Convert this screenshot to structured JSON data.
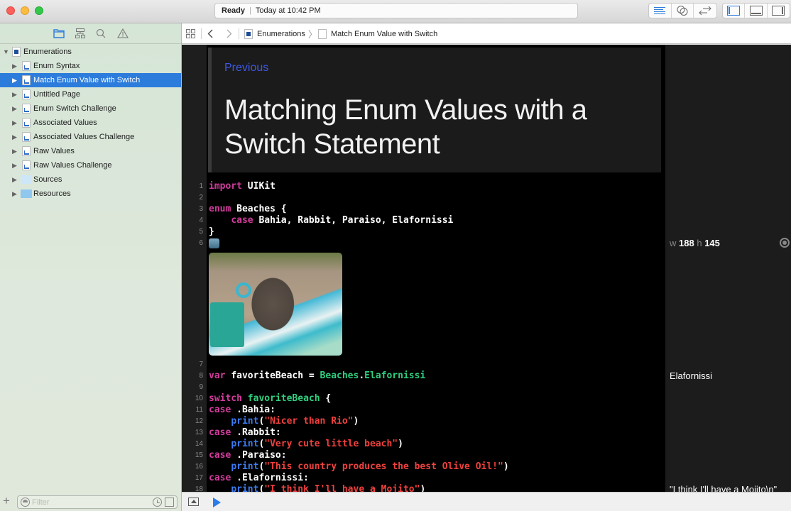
{
  "window": {
    "status": {
      "state": "Ready",
      "time": "Today at 10:42 PM"
    },
    "toolbar": {
      "editor_modes": [
        "standard-editor-icon",
        "assistant-editor-icon",
        "version-editor-icon"
      ],
      "view_toggles": [
        "navigator-toggle-icon",
        "debug-area-toggle-icon",
        "utilities-toggle-icon"
      ]
    }
  },
  "navigator": {
    "tabs": [
      "project-navigator-icon",
      "symbol-navigator-icon",
      "find-navigator-icon",
      "issue-navigator-icon"
    ],
    "root": {
      "label": "Enumerations",
      "expanded": true
    },
    "items": [
      {
        "label": "Enum Syntax",
        "type": "page",
        "selected": false
      },
      {
        "label": "Match Enum Value with Switch",
        "type": "page",
        "selected": true
      },
      {
        "label": "Untitled Page",
        "type": "page",
        "selected": false
      },
      {
        "label": "Enum Switch Challenge",
        "type": "page",
        "selected": false
      },
      {
        "label": "Associated Values",
        "type": "page",
        "selected": false
      },
      {
        "label": "Associated Values Challenge",
        "type": "page",
        "selected": false
      },
      {
        "label": "Raw Values",
        "type": "page",
        "selected": false
      },
      {
        "label": "Raw Values Challenge",
        "type": "page",
        "selected": false
      },
      {
        "label": "Sources",
        "type": "folder",
        "selected": false
      },
      {
        "label": "Resources",
        "type": "folder",
        "selected": false
      }
    ],
    "filter": {
      "placeholder": "Filter",
      "value": ""
    }
  },
  "jumpbar": {
    "breadcrumb": [
      "Enumerations",
      "Match Enum Value with Switch"
    ]
  },
  "editor": {
    "doc": {
      "previous_link": "Previous",
      "title": "Matching Enum Values with a Switch Statement"
    },
    "lines": [
      {
        "n": "1",
        "text": "import UIKit"
      },
      {
        "n": "2",
        "text": ""
      },
      {
        "n": "3",
        "text": "enum Beaches {"
      },
      {
        "n": "4",
        "text": "    case Bahia, Rabbit, Paraiso, Elafornissi"
      },
      {
        "n": "5",
        "text": "}"
      },
      {
        "n": "6",
        "text": "[image literal]"
      },
      {
        "n": "7",
        "text": ""
      },
      {
        "n": "8",
        "text": "var favoriteBeach = Beaches.Elafornissi"
      },
      {
        "n": "9",
        "text": ""
      },
      {
        "n": "10",
        "text": "switch favoriteBeach {"
      },
      {
        "n": "11",
        "text": "case .Bahia:"
      },
      {
        "n": "12",
        "text": "    print(\"Nicer than Rio\")"
      },
      {
        "n": "13",
        "text": "case .Rabbit:"
      },
      {
        "n": "14",
        "text": "    print(\"Very cute little beach\")"
      },
      {
        "n": "15",
        "text": "case .Paraiso:"
      },
      {
        "n": "16",
        "text": "    print(\"This country produces the best Olive Oil!\")"
      },
      {
        "n": "17",
        "text": "case .Elafornissi:"
      },
      {
        "n": "18",
        "text": "    print(\"I think I'll have a Mojito\")"
      }
    ],
    "tokens": {
      "l1": [
        "import",
        "UIKit"
      ],
      "l3": [
        "enum",
        "Beaches {"
      ],
      "l4": [
        "case",
        "Bahia, Rabbit, Paraiso, Elafornissi"
      ],
      "l5": [
        "}"
      ],
      "l8": [
        "var",
        "favoriteBeach =",
        "Beaches",
        ".",
        "Elafornissi"
      ],
      "l10": [
        "switch",
        "favoriteBeach",
        "{"
      ],
      "l11": [
        "case",
        ".Bahia:"
      ],
      "l12": [
        "print",
        "(",
        "\"Nicer than Rio\"",
        ")"
      ],
      "l13": [
        "case",
        ".Rabbit:"
      ],
      "l14": [
        "print",
        "(",
        "\"Very cute little beach\"",
        ")"
      ],
      "l15": [
        "case",
        ".Paraiso:"
      ],
      "l16": [
        "print",
        "(",
        "\"This country produces the best Olive Oil!\"",
        ")"
      ],
      "l17": [
        "case",
        ".Elafornissi:"
      ],
      "l18": [
        "print",
        "(",
        "\"I think I'll have a Mojito\"",
        ")"
      ]
    },
    "image_literal": {
      "description": "rabbit on beach towel"
    }
  },
  "results": {
    "image": {
      "w_label": "w",
      "w": "188",
      "h_label": "h",
      "h": "145"
    },
    "line8": "Elafornissi",
    "line18": "\"I think I'll have a Mojito\\n\""
  },
  "colors": {
    "selection": "#2c7cdc",
    "keyword": "#d23c9c",
    "type": "#2fd07f",
    "function": "#3b7bf2",
    "string": "#f0403e",
    "link": "#3d59e6"
  }
}
